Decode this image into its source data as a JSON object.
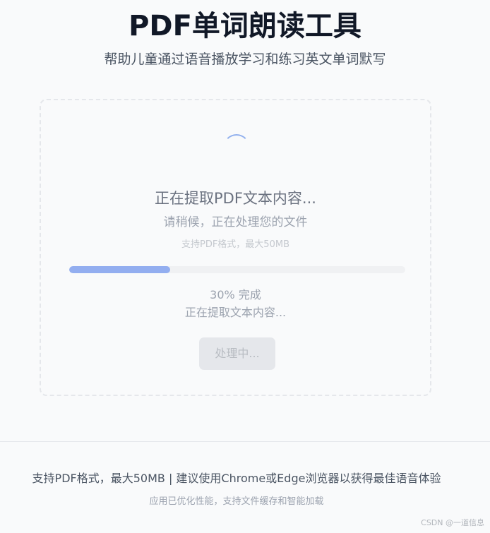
{
  "header": {
    "title": "PDF单词朗读工具",
    "subtitle": "帮助儿童通过语音播放学习和练习英文单词默写"
  },
  "processing": {
    "title": "正在提取PDF文本内容...",
    "subtitle": "请稍候，正在处理您的文件",
    "format_hint": "支持PDF格式，最大50MB",
    "progress_percent": 30,
    "progress_label": "30% 完成",
    "stage_label": "正在提取文本内容...",
    "button_label": "处理中..."
  },
  "footer": {
    "main": "支持PDF格式，最大50MB | 建议使用Chrome或Edge浏览器以获得最佳语音体验",
    "sub": "应用已优化性能，支持文件缓存和智能加载"
  },
  "watermark": "CSDN @一道信息",
  "colors": {
    "accent": "#93aef0",
    "background": "#f9fafb"
  },
  "icons": {
    "spinner": "loading-spinner-icon"
  }
}
